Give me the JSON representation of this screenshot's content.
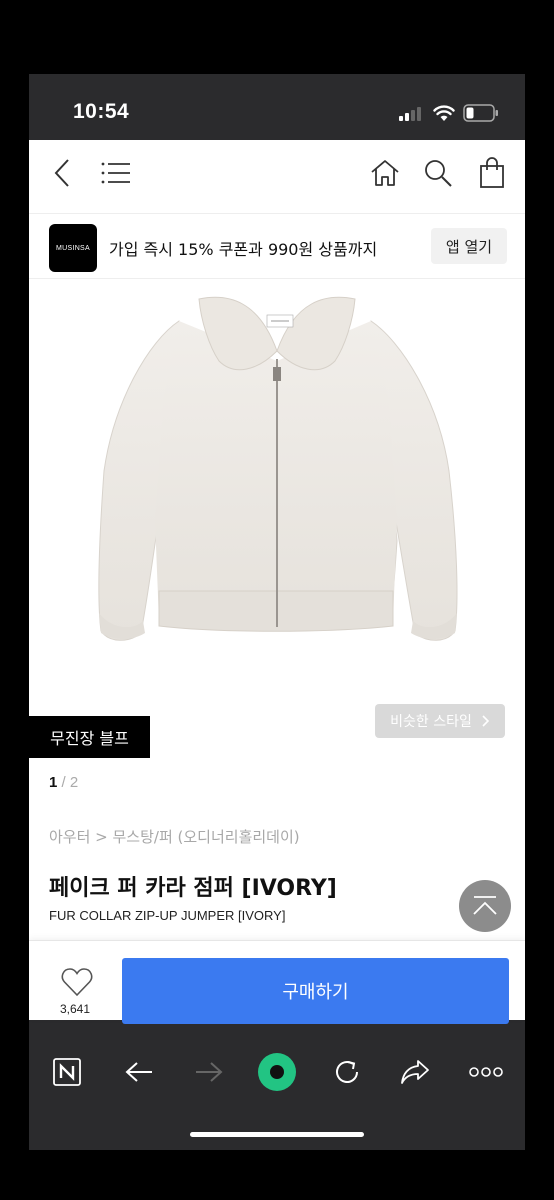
{
  "status_bar": {
    "time": "10:54"
  },
  "banner": {
    "logo_text": "MUSINSA",
    "promo_text": "가입 즉시 15% 쿠폰과 990원 상품까지",
    "open_app_label": "앱 열기"
  },
  "product": {
    "store_tag": "무진장 블프",
    "similar_style_label": "비슷한 스타일",
    "image_page_current": "1",
    "image_page_separator": "/",
    "image_page_total": "2",
    "breadcrumb": "아우터 > 무스탕/퍼 (오디너리홀리데이)",
    "title_ko": "페이크 퍼 카라 점퍼 [IVORY]",
    "title_en": "FUR COLLAR ZIP-UP JUMPER [IVORY]"
  },
  "buy_bar": {
    "like_count": "3,641",
    "buy_label": "구매하기"
  },
  "colors": {
    "accent_blue": "#3b7af0",
    "browser_green": "#22c483",
    "dark_bar": "#2b2b2d"
  },
  "browser_toolbar": {
    "icons": [
      "naver-n-icon",
      "back-arrow-icon",
      "forward-arrow-icon",
      "green-dot-icon",
      "refresh-icon",
      "share-icon",
      "more-icon"
    ]
  }
}
